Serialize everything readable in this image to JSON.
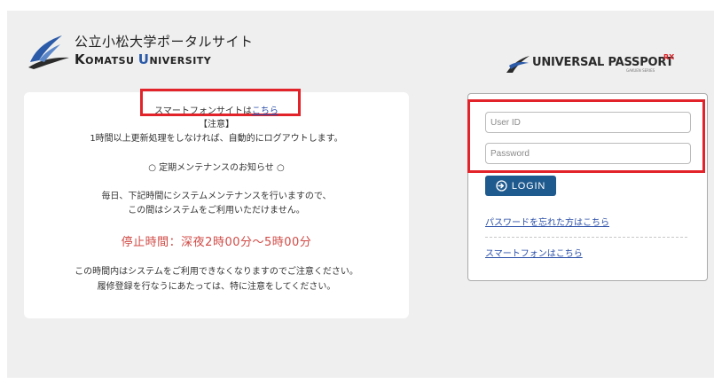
{
  "logo": {
    "name_jp": "公立小松大学ポータルサイト",
    "name_en_k": "K",
    "name_en_omatsu": "OMATSU ",
    "name_en_u": "U",
    "name_en_niversity": "NIVERSITY"
  },
  "brand": {
    "name": "UNIVERSAL PASSPORT",
    "superscript": "RX",
    "subtitle": "GAKUEN SERIES"
  },
  "notice": {
    "smartphone_prefix": "スマートフォンサイトは",
    "smartphone_link": "こちら",
    "heading": "【注意】",
    "auto_logout": "1時間以上更新処理をしなければ、自動的にログアウトします。",
    "maintenance_title": "○ 定期メンテナンスのお知らせ ○",
    "maintenance_line1": "毎日、下記時間にシステムメンテナンスを行いますので、",
    "maintenance_line2": "この間はシステムをご利用いただけません。",
    "stop_time": "停止時間：深夜2時00分～5時00分",
    "caution_line1": "この時間内はシステムをご利用できなくなりますのでご注意ください。",
    "caution_line2": "履修登録を行なうにあたっては、特に注意をしてください。"
  },
  "login": {
    "user_id_placeholder": "User ID",
    "user_id_value": "",
    "password_placeholder": "Password",
    "password_value": "",
    "button_label": "LOGIN",
    "forgot_password": "パスワードを忘れた方はこちら",
    "smartphone_link": "スマートフォンはこちら"
  },
  "colors": {
    "highlight_box": "#e2232a",
    "login_button": "#1f5a8e",
    "link": "#2b4fa8",
    "stop_time_text": "#d04b46",
    "logo_u": "#2b5aa8",
    "brand_rx": "#d6262b"
  },
  "icons": {
    "logo": "university-crane-logo",
    "brand": "swoosh-logo",
    "login_button": "login-arrow-icon"
  }
}
